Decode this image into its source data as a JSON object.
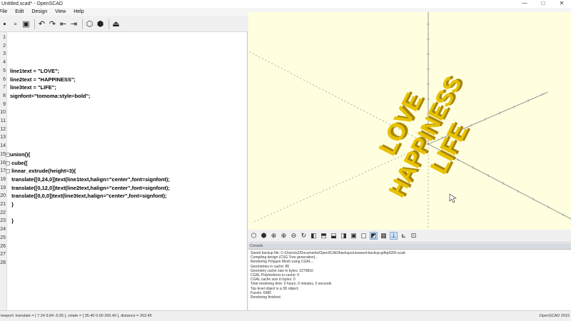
{
  "window": {
    "title": "Untitled.scad* - OpenSCAD",
    "minimize": "—",
    "maximize": "□",
    "close": "✕"
  },
  "menu": [
    "File",
    "Edit",
    "Design",
    "View",
    "Help"
  ],
  "toolbar": {
    "icons": [
      "new-icon",
      "open-icon",
      "save-icon",
      "undo-icon",
      "redo-icon",
      "unindent-icon",
      "indent-icon",
      "preview-icon",
      "render-icon",
      "export-stl-icon"
    ]
  },
  "editor": {
    "lines": [
      {
        "n": "1",
        "text": ""
      },
      {
        "n": "2",
        "text": ""
      },
      {
        "n": "3",
        "text": ""
      },
      {
        "n": "4",
        "text": ""
      },
      {
        "n": "5",
        "text": "line1text = \"LOVE\";"
      },
      {
        "n": "6",
        "text": "line2text = \"HAPPINESS\";"
      },
      {
        "n": "7",
        "text": "line3text = \"LIFE\";"
      },
      {
        "n": "8",
        "text": "signfont=\"tomoma:style=bold\";"
      },
      {
        "n": "9",
        "text": ""
      },
      {
        "n": "10",
        "text": ""
      },
      {
        "n": "11",
        "text": ""
      },
      {
        "n": "12",
        "text": ""
      },
      {
        "n": "13",
        "text": ""
      },
      {
        "n": "14",
        "text": ""
      },
      {
        "n": "15",
        "text": "union(){"
      },
      {
        "n": "16",
        "text": " cube(["
      },
      {
        "n": "17",
        "text": " linear_extrude(height=3){"
      },
      {
        "n": "18",
        "text": " translate([0,24,0])text(line1text,halign=\"center\",font=signfont);"
      },
      {
        "n": "19",
        "text": " translate([0,12,0])text(line2text,halign=\"center\",font=signfont);"
      },
      {
        "n": "20",
        "text": " translate([0,0,0])text(line3text,halign=\"center\",font=signfont);"
      },
      {
        "n": "21",
        "text": " }"
      },
      {
        "n": "22",
        "text": ""
      },
      {
        "n": "23",
        "text": " }"
      },
      {
        "n": "24",
        "text": ""
      },
      {
        "n": "25",
        "text": ""
      },
      {
        "n": "26",
        "text": ""
      },
      {
        "n": "27",
        "text": ""
      },
      {
        "n": "28",
        "text": ""
      }
    ]
  },
  "viewport": {
    "background": "#ffffe0",
    "text_color": "#e8c200",
    "shadow_color": "#a8860a",
    "words": [
      "LOVE",
      "HAPPINESS",
      "LIFE"
    ]
  },
  "viewtoolbar": {
    "icons": [
      "preview-icon",
      "render-icon",
      "zoom-all-icon",
      "zoom-in-icon",
      "zoom-out-icon",
      "reset-view-icon",
      "view-right-icon",
      "view-top-icon",
      "view-bottom-icon",
      "view-left-icon",
      "view-front-icon",
      "view-back-icon",
      "view-diagonal-icon",
      "view-center-icon",
      "perspective-icon",
      "orthogonal-icon",
      "show-axes-icon",
      "show-edges-icon"
    ]
  },
  "console": {
    "header": "Console",
    "lines": [
      "Saved backup file: C:/Users/s2/Documents/OpenSCAD/backups/unsaved-backup-gdhp9260.scad",
      "Compiling design (CSG Tree generation)...",
      "Rendering Polygon Mesh using CGAL...",
      "Geometries in cache: 86",
      "Geometry cache size in bytes: 2276816",
      "CGAL Polyhedrons in cache: 0",
      "CGAL cache size in bytes: 0",
      "Total rendering time: 0 hours, 0 minutes, 0 seconds",
      "   Top level object is a 3D object:",
      "   Facets:       6980",
      "Rendering finished."
    ]
  },
  "status": {
    "left": "iewport: translate = [ 7.24 9.84 -5.55 ], rotate = [ 35.40 0.00 265.40 ], distance = 263.45",
    "right": "OpenSCAD 2015"
  }
}
